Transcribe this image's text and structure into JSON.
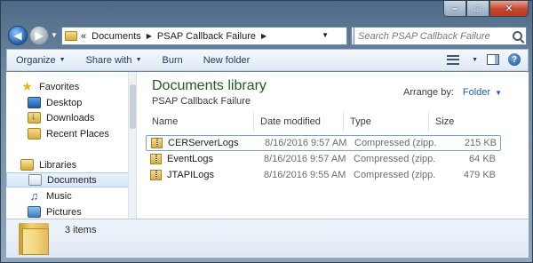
{
  "window": {
    "controls": {
      "minimize": "–",
      "maximize": "□",
      "close": "✕"
    }
  },
  "nav": {
    "back_glyph": "◀",
    "forward_glyph": "▶",
    "address": {
      "overflow": "«",
      "crumbs": [
        "Documents",
        "PSAP Callback Failure"
      ],
      "separator": "▶"
    },
    "refresh_glyph": "↻",
    "search_placeholder": "Search PSAP Callback Failure"
  },
  "toolbar": {
    "organize": "Organize",
    "share_with": "Share with",
    "burn": "Burn",
    "new_folder": "New folder"
  },
  "sidebar": {
    "favorites_header": "Favorites",
    "favorites": [
      "Desktop",
      "Downloads",
      "Recent Places"
    ],
    "libraries_header": "Libraries",
    "libraries": [
      "Documents",
      "Music",
      "Pictures"
    ]
  },
  "content": {
    "title": "Documents library",
    "subtitle": "PSAP Callback Failure",
    "arrange_label": "Arrange by:",
    "arrange_value": "Folder",
    "columns": {
      "name": "Name",
      "date": "Date modified",
      "type": "Type",
      "size": "Size"
    },
    "files": [
      {
        "name": "CERServerLogs",
        "date": "8/16/2016 9:57 AM",
        "type": "Compressed (zipp...",
        "size": "215 KB"
      },
      {
        "name": "EventLogs",
        "date": "8/16/2016 9:57 AM",
        "type": "Compressed (zipp...",
        "size": "64 KB"
      },
      {
        "name": "JTAPILogs",
        "date": "8/16/2016 9:55 AM",
        "type": "Compressed (zipp...",
        "size": "479 KB"
      }
    ]
  },
  "details": {
    "item_count": "3 items"
  }
}
